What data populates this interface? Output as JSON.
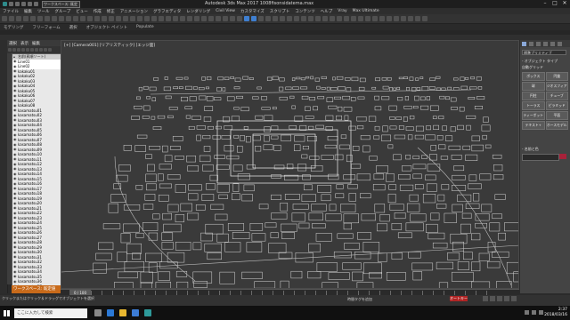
{
  "app": {
    "title": "Autodesk 3ds Max 2017    1008fisonsidatema.max",
    "workspace_dropdown": "ワークスペース: 既定"
  },
  "menubar": {
    "items": [
      "ファイル",
      "編集",
      "ツール",
      "グループ",
      "ビュー",
      "作成",
      "修正",
      "アニメーション",
      "グラフエディタ",
      "レンダリング",
      "Civil View",
      "カスタマイズ",
      "スクリプト",
      "コンテンツ",
      "ヘルプ",
      "Vray",
      "Max Ultimate"
    ]
  },
  "ribbon": {
    "tabs": [
      "モデリング",
      "フリーフォーム",
      "選択",
      "オブジェクト ペイント",
      "Populate"
    ]
  },
  "scene_explorer": {
    "tabs": [
      "選択",
      "表示",
      "編集"
    ],
    "header": "名前(昇順ソート)",
    "items": [
      "Line01",
      "Line02",
      "kakaku01",
      "kakaku02",
      "kakaku03",
      "kakaku04",
      "kakaku05",
      "kakaku06",
      "kakaku07",
      "kakaku08",
      "kasamatsu01",
      "kasamatsu02",
      "kasamatsu03",
      "kasamatsu04",
      "kasamatsu05",
      "kasamatsu06",
      "kasamatsu07",
      "kasamatsu08",
      "kasamatsu09",
      "kasamatsu10",
      "kasamatsu11",
      "kasamatsu12",
      "kasamatsu13",
      "kasamatsu14",
      "kasamatsu15",
      "kasamatsu16",
      "kasamatsu17",
      "kasamatsu18",
      "kasamatsu19",
      "kasamatsu20",
      "kasamatsu21",
      "kasamatsu22",
      "kasamatsu23",
      "kasamatsu24",
      "kasamatsu25",
      "kasamatsu26",
      "kasamatsu27",
      "kasamatsu28",
      "kasamatsu29",
      "kasamatsu30",
      "kasamatsu31",
      "kasamatsu32",
      "kasamatsu33",
      "kasamatsu34",
      "kasamatsu35",
      "kasamatsu36",
      "kasamatsu37"
    ],
    "workspace_label": "ワークスペース: 既定値"
  },
  "viewport": {
    "label": "[+] [Camera001] [リアリスティック] [エッジ面]"
  },
  "command_panel": {
    "dropdown": "標準プリミティブ",
    "rollout_object_type": "- オブジェクト タイプ",
    "autogrid": "自動グリッド",
    "objects": [
      "ボックス",
      "円錐",
      "球",
      "ジオスフィア",
      "円柱",
      "チューブ",
      "トーラス",
      "ピラミッド",
      "ティーポット",
      "平面",
      "テキスト+",
      "ホースモデル"
    ],
    "rollout_name_color": "- 名前と色",
    "swatch_color": "#a8223a"
  },
  "timeline": {
    "slider": "0 / 100"
  },
  "status": {
    "text": "クリックまたはクリック＆ドラッグでオブジェクトを選択",
    "add_time_tag": "時間タグを追加",
    "auto_key": "オートキー"
  },
  "taskbar": {
    "search_placeholder": "ここに入力して検索",
    "time": "2:37",
    "date": "2018/03/16"
  }
}
